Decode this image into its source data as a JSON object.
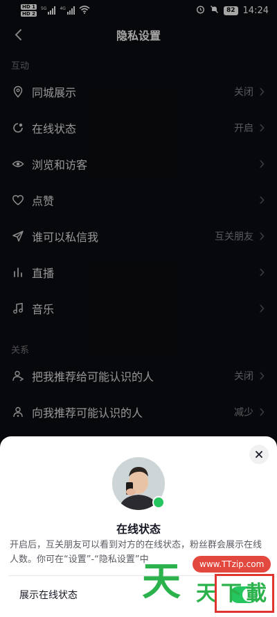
{
  "status_bar": {
    "hd1": "HD 1",
    "hd2": "HD 2",
    "net1": "5G",
    "net2": "4G",
    "battery": "82",
    "time": "14:24"
  },
  "header": {
    "title": "隐私设置"
  },
  "sections": {
    "interaction": "互动",
    "relationship": "关系"
  },
  "rows": [
    {
      "label": "同城展示",
      "value": "关闭",
      "icon": "location-pin-icon"
    },
    {
      "label": "在线状态",
      "value": "开启",
      "icon": "online-status-icon"
    },
    {
      "label": "浏览和访客",
      "value": "",
      "icon": "eye-icon"
    },
    {
      "label": "点赞",
      "value": "",
      "icon": "heart-icon"
    },
    {
      "label": "谁可以私信我",
      "value": "互关朋友",
      "icon": "send-icon"
    },
    {
      "label": "直播",
      "value": "",
      "icon": "live-bars-icon"
    },
    {
      "label": "音乐",
      "value": "",
      "icon": "music-note-icon"
    },
    {
      "label": "把我推荐给可能认识的人",
      "value": "关闭",
      "icon": "recommend-me-icon"
    },
    {
      "label": "向我推荐可能认识的人",
      "value": "减少",
      "icon": "recommend-to-me-icon"
    }
  ],
  "sheet": {
    "title": "在线状态",
    "description": "开启后，互关朋友可以看到对方的在线状态，粉丝群会展示在线人数。你可在“设置”-“隐私设置”中",
    "toggle_label": "展示在线状态",
    "toggle_on": true
  },
  "watermark": {
    "url": "www.TTzip.com",
    "big": "天",
    "small": "天下載"
  },
  "colors": {
    "background": "#0c0d11",
    "sheet": "#ffffff",
    "online_green": "#25c55f",
    "watermark_green": "#2bb24c",
    "watermark_red": "#e2483d"
  }
}
